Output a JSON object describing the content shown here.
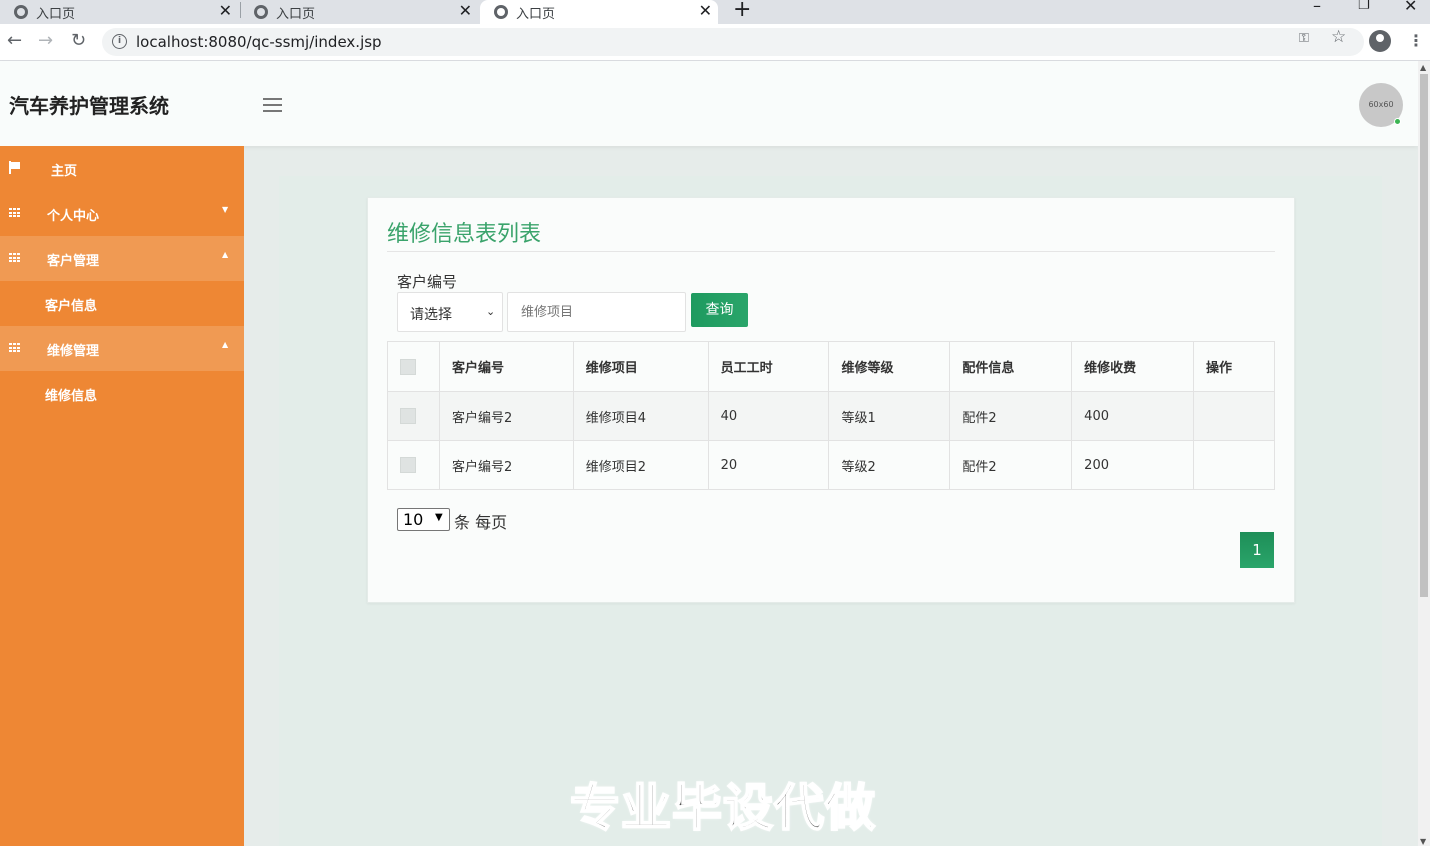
{
  "browser": {
    "tabs": [
      {
        "title": "入口页",
        "active": false
      },
      {
        "title": "入口页",
        "active": false
      },
      {
        "title": "入口页",
        "active": true
      }
    ],
    "new_tab": "+",
    "url": "localhost:8080/qc-ssmj/index.jsp",
    "window_controls": {
      "minimize": "–",
      "restore": "❐",
      "close": "✕"
    }
  },
  "header": {
    "app_title": "汽车养护管理系统",
    "avatar_text": "60x60"
  },
  "sidebar": {
    "items": [
      {
        "label": "主页",
        "icon": "flag-icon",
        "expanded": false
      },
      {
        "label": "个人中心",
        "icon": "grid-icon",
        "expanded": false
      },
      {
        "label": "客户管理",
        "icon": "grid-icon",
        "expanded": true,
        "children": [
          {
            "label": "客户信息"
          }
        ]
      },
      {
        "label": "维修管理",
        "icon": "grid-icon",
        "expanded": true,
        "children": [
          {
            "label": "维修信息"
          }
        ]
      }
    ]
  },
  "main": {
    "title": "维修信息表列表",
    "filter": {
      "label": "客户编号",
      "select_value": "请选择",
      "input_placeholder": "维修项目",
      "query_label": "查询"
    },
    "table": {
      "columns": [
        "客户编号",
        "维修项目",
        "员工工时",
        "维修等级",
        "配件信息",
        "维修收费",
        "操作"
      ],
      "rows": [
        [
          "客户编号2",
          "维修项目4",
          "40",
          "等级1",
          "配件2",
          "400",
          ""
        ],
        [
          "客户编号2",
          "维修项目2",
          "20",
          "等级2",
          "配件2",
          "200",
          ""
        ]
      ]
    },
    "pagination": {
      "page_size": "10",
      "per_page_label": "条 每页",
      "current_page": "1"
    }
  },
  "watermark": "专业毕设代做",
  "colors": {
    "sidebar": "#ee8734",
    "accent_green": "#1e9a5f",
    "title_green": "#3aa36b"
  }
}
